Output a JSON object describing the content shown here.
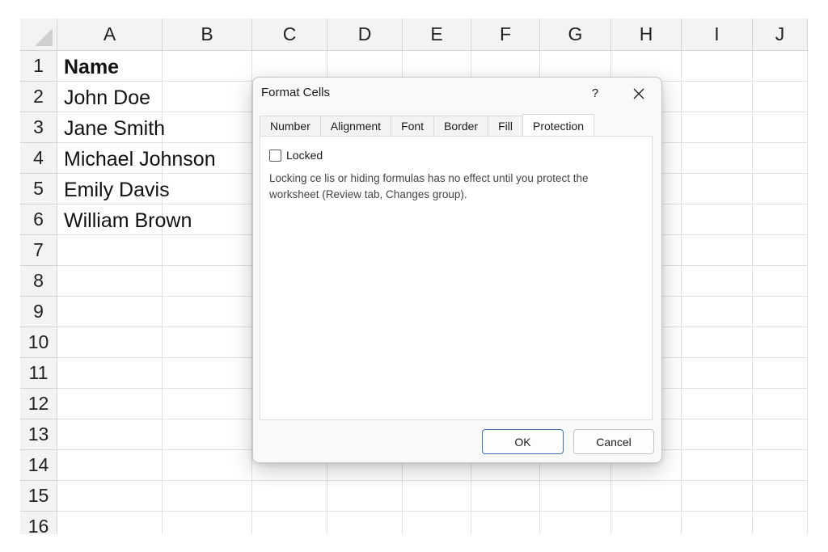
{
  "sheet": {
    "columns": [
      "A",
      "B",
      "C",
      "D",
      "E",
      "F",
      "G",
      "H",
      "I",
      "J"
    ],
    "rows": [
      "1",
      "2",
      "3",
      "4",
      "5",
      "6",
      "7",
      "8",
      "9",
      "10",
      "11",
      "12",
      "13",
      "14",
      "15",
      "16"
    ],
    "cells": {
      "A1": "Name",
      "A2": "John Doe",
      "A3": "Jane Smith",
      "A4": "Michael Johnson",
      "A5": "Emily Davis",
      "A6": "William Brown"
    }
  },
  "dialog": {
    "title": "Format Cells",
    "help_label": "?",
    "tabs": [
      "Number",
      "Alignment",
      "Font",
      "Border",
      "Fill",
      "Protection"
    ],
    "active_tab": "Protection",
    "locked_label": "Locked",
    "locked_checked": false,
    "info_text": "Locking ce lis or hiding formulas has no effect until you protect the worksheet (Review tab, Changes group).",
    "ok_label": "OK",
    "cancel_label": "Cancel"
  }
}
